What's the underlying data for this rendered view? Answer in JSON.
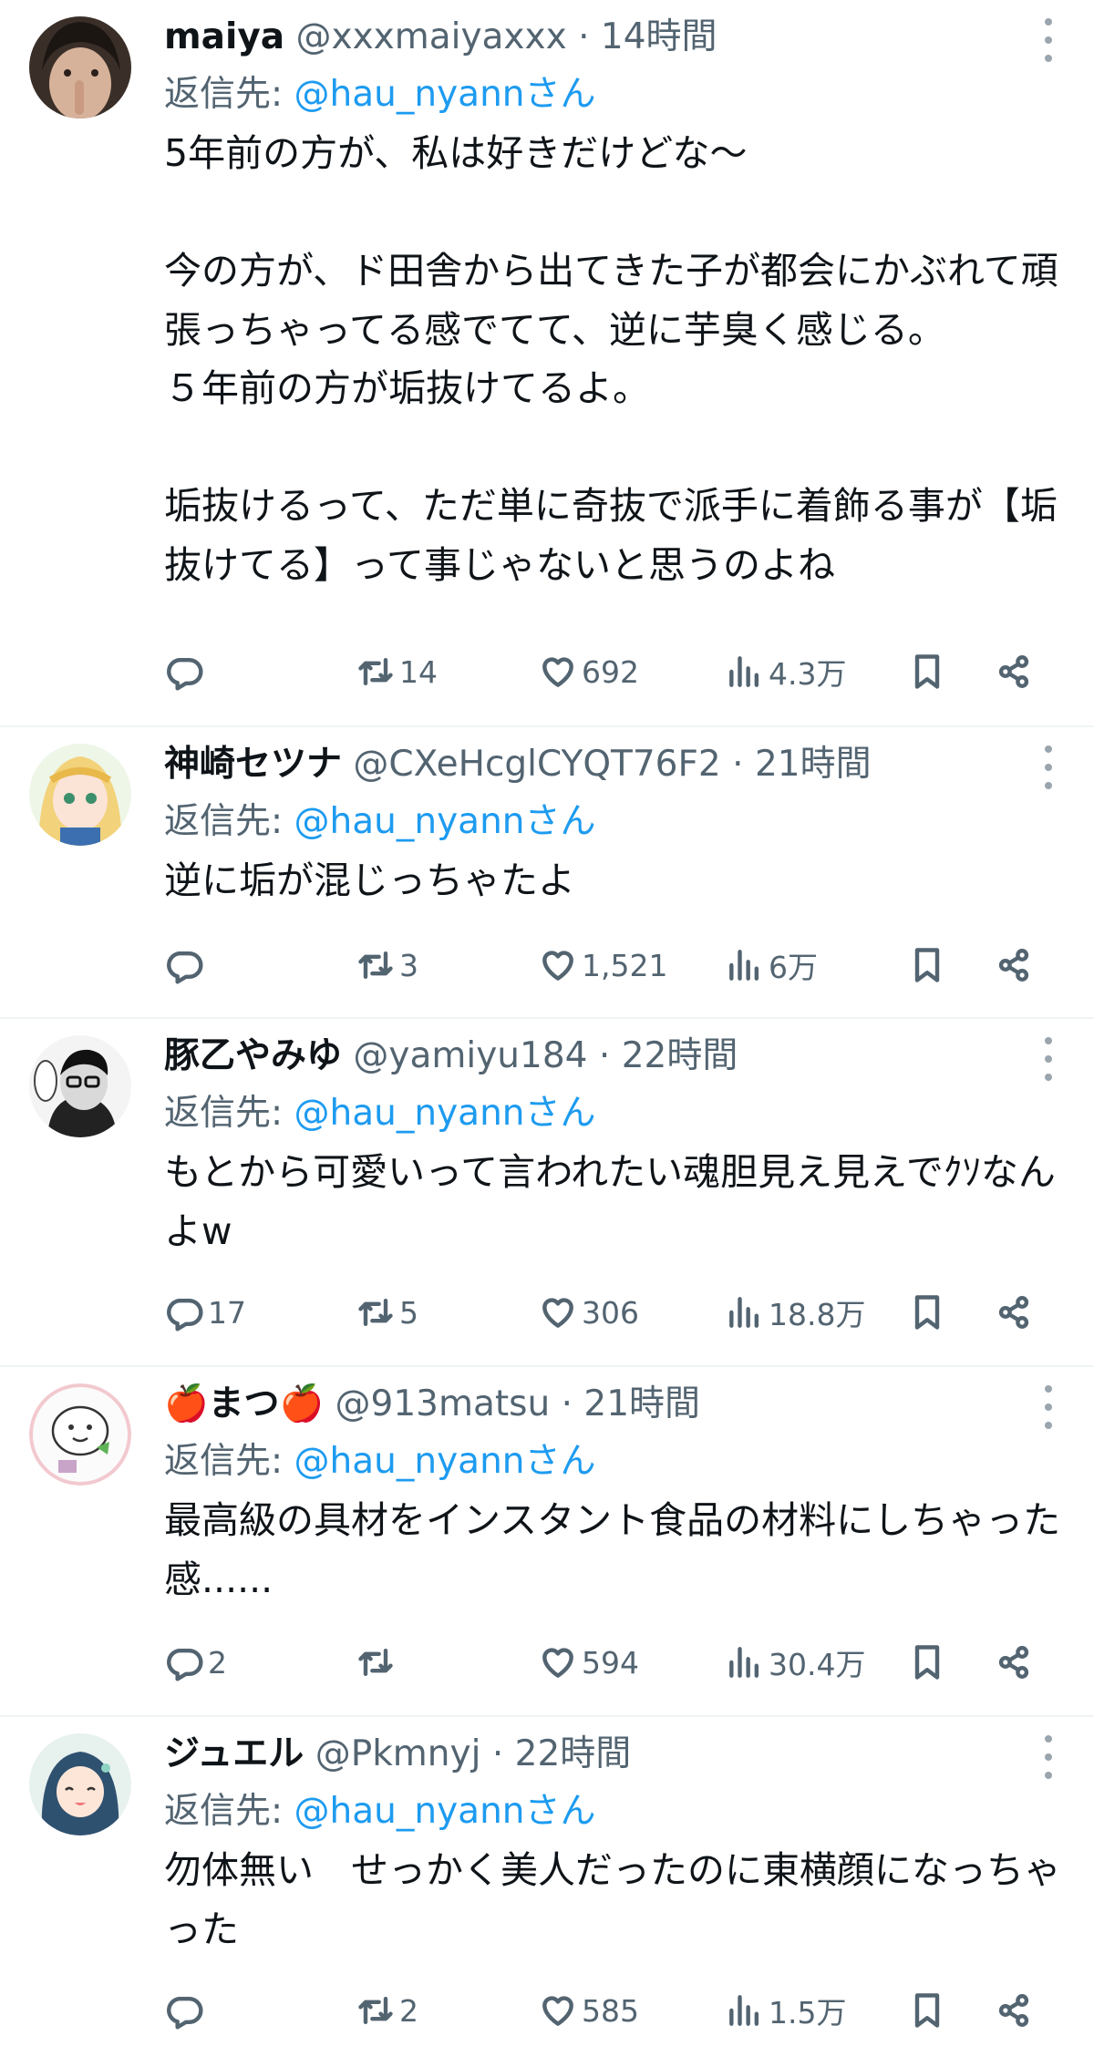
{
  "reply_prefix": "返信先: ",
  "tweets": [
    {
      "name": "maiya",
      "handle": "@xxxmaiyaxxx",
      "separator": "·",
      "time": "14時間",
      "reply_to": "@hau_nyannさん",
      "text": "5年前の方が、私は好きだけどな〜\n\n今の方が、ド田舎から出てきた子が都会にかぶれて頑張っちゃってる感でてて、逆に芋臭く感じる。\n５年前の方が垢抜けてるよ。\n\n垢抜けるって、ただ単に奇抜で派手に着飾る事が【垢抜けてる】って事じゃないと思うのよね",
      "replies": "",
      "retweets": "14",
      "likes": "692",
      "views": "4.3万"
    },
    {
      "name": "神崎セツナ",
      "handle": "@CXeHcglCYQT76F2",
      "separator": "·",
      "time": "21時間",
      "reply_to": "@hau_nyannさん",
      "text": "逆に垢が混じっちゃたよ",
      "replies": "",
      "retweets": "3",
      "likes": "1,521",
      "views": "6万"
    },
    {
      "name": "豚乙やみゆ",
      "handle": "@yamiyu184",
      "separator": "·",
      "time": "22時間",
      "reply_to": "@hau_nyannさん",
      "text": "もとから可愛いって言われたい魂胆見え見えでｸｿなんよw",
      "replies": "17",
      "retweets": "5",
      "likes": "306",
      "views": "18.8万"
    },
    {
      "name": "🍎まつ🍎",
      "handle": "@913matsu",
      "separator": "·",
      "time": "21時間",
      "reply_to": "@hau_nyannさん",
      "text": "最高級の具材をインスタント食品の材料にしちゃった感......",
      "replies": "2",
      "retweets": "",
      "likes": "594",
      "views": "30.4万"
    },
    {
      "name": "ジュエル",
      "handle": "@Pkmnyj",
      "separator": "·",
      "time": "22時間",
      "reply_to": "@hau_nyannさん",
      "text": "勿体無い　せっかく美人だったのに東横顔になっちゃった",
      "replies": "",
      "retweets": "2",
      "likes": "585",
      "views": "1.5万"
    }
  ],
  "icons": {
    "reply": "speech-bubble-icon",
    "retweet": "retweet-arrows-icon",
    "like": "heart-outline-icon",
    "views": "bar-chart-icon",
    "bookmark": "bookmark-icon",
    "share": "share-nodes-icon",
    "more": "vertical-dots-icon"
  }
}
